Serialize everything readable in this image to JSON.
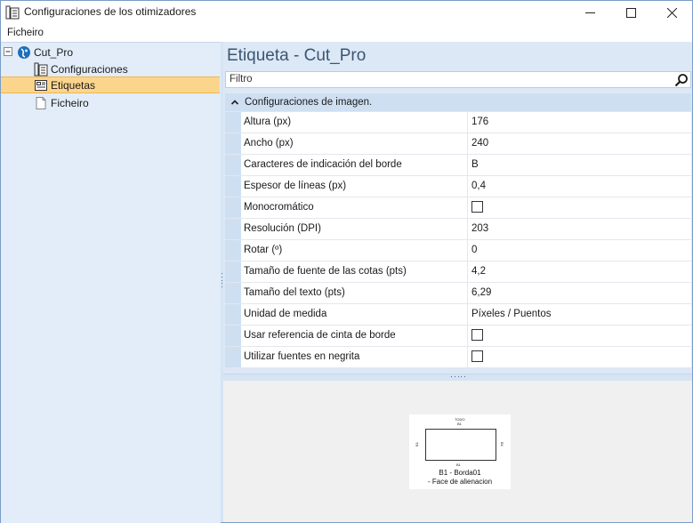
{
  "window": {
    "title": "Configuraciones de los otimizadores",
    "app_icon": "settings-sheet-icon"
  },
  "menu": {
    "items": [
      "Ficheiro"
    ]
  },
  "tree": {
    "root": {
      "label": "Cut_Pro",
      "icon": "globe-icon"
    },
    "children": [
      {
        "label": "Configuraciones",
        "icon": "settings-sheet-icon"
      },
      {
        "label": "Etiquetas",
        "icon": "label-sheet-icon",
        "selected": true
      },
      {
        "label": "Ficheiro",
        "icon": "blank-file-icon"
      }
    ]
  },
  "main": {
    "title": "Etiqueta - Cut_Pro",
    "filter_placeholder": "Filtro",
    "category": "Configuraciones de imagen.",
    "properties": [
      {
        "name": "Altura (px)",
        "value": "176"
      },
      {
        "name": "Ancho (px)",
        "value": "240"
      },
      {
        "name": "Caracteres de indicación del borde",
        "value": "B"
      },
      {
        "name": "Espesor de líneas (px)",
        "value": "0,4"
      },
      {
        "name": "Monocromático",
        "checkbox": true,
        "checked": false
      },
      {
        "name": "Resolución (DPI)",
        "value": "203"
      },
      {
        "name": "Rotar (º)",
        "value": "0"
      },
      {
        "name": "Tamaño de fuente de las cotas (pts)",
        "value": "4,2"
      },
      {
        "name": "Tamaño del texto (pts)",
        "value": "6,29"
      },
      {
        "name": "Unidad de medida",
        "value": "Píxeles / Puentos"
      },
      {
        "name": "Usar referencia de cinta de borde",
        "checkbox": true,
        "checked": false
      },
      {
        "name": "Utilizar fuentes en negrita",
        "checkbox": true,
        "checked": false
      }
    ]
  },
  "preview": {
    "top_text": "TODO",
    "top_sub": "B1",
    "left_text": "B1",
    "right_text": "B1",
    "bottom_text": "B1",
    "caption1": "B1 - Borda01",
    "caption2": "- Face de alienacion"
  }
}
